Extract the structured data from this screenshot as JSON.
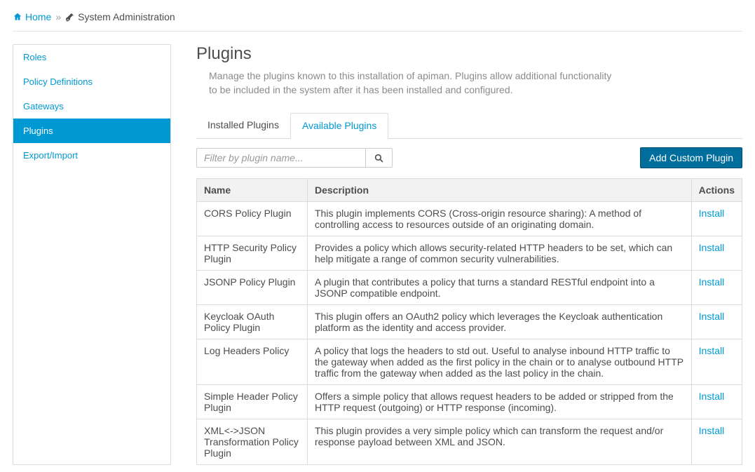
{
  "breadcrumb": {
    "home": "Home",
    "current": "System Administration"
  },
  "sidebar": {
    "items": [
      {
        "label": "Roles",
        "active": false
      },
      {
        "label": "Policy Definitions",
        "active": false
      },
      {
        "label": "Gateways",
        "active": false
      },
      {
        "label": "Plugins",
        "active": true
      },
      {
        "label": "Export/Import",
        "active": false
      }
    ]
  },
  "page": {
    "title": "Plugins",
    "description": "Manage the plugins known to this installation of apiman. Plugins allow additional functionality to be included in the system after it has been installed and configured."
  },
  "tabs": {
    "installed": "Installed Plugins",
    "available": "Available Plugins"
  },
  "toolbar": {
    "filter_placeholder": "Filter by plugin name...",
    "add_custom": "Add Custom Plugin"
  },
  "table": {
    "headers": {
      "name": "Name",
      "description": "Description",
      "actions": "Actions"
    },
    "install_label": "Install",
    "rows": [
      {
        "name": "CORS Policy Plugin",
        "description": "This plugin implements CORS (Cross-origin resource sharing): A method of controlling access to resources outside of an originating domain."
      },
      {
        "name": "HTTP Security Policy Plugin",
        "description": "Provides a policy which allows security-related HTTP headers to be set, which can help mitigate a range of common security vulnerabilities."
      },
      {
        "name": "JSONP Policy Plugin",
        "description": "A plugin that contributes a policy that turns a standard RESTful endpoint into a JSONP compatible endpoint."
      },
      {
        "name": "Keycloak OAuth Policy Plugin",
        "description": "This plugin offers an OAuth2 policy which leverages the Keycloak authentication platform as the identity and access provider."
      },
      {
        "name": "Log Headers Policy",
        "description": "A policy that logs the headers to std out. Useful to analyse inbound HTTP traffic to the gateway when added as the first policy in the chain or to analyse outbound HTTP traffic from the gateway when added as the last policy in the chain."
      },
      {
        "name": "Simple Header Policy Plugin",
        "description": "Offers a simple policy that allows request headers to be added or stripped from the HTTP request (outgoing) or HTTP response (incoming)."
      },
      {
        "name": "XML<->JSON Transformation Policy Plugin",
        "description": "This plugin provides a very simple policy which can transform the request and/or response payload between XML and JSON."
      }
    ]
  }
}
